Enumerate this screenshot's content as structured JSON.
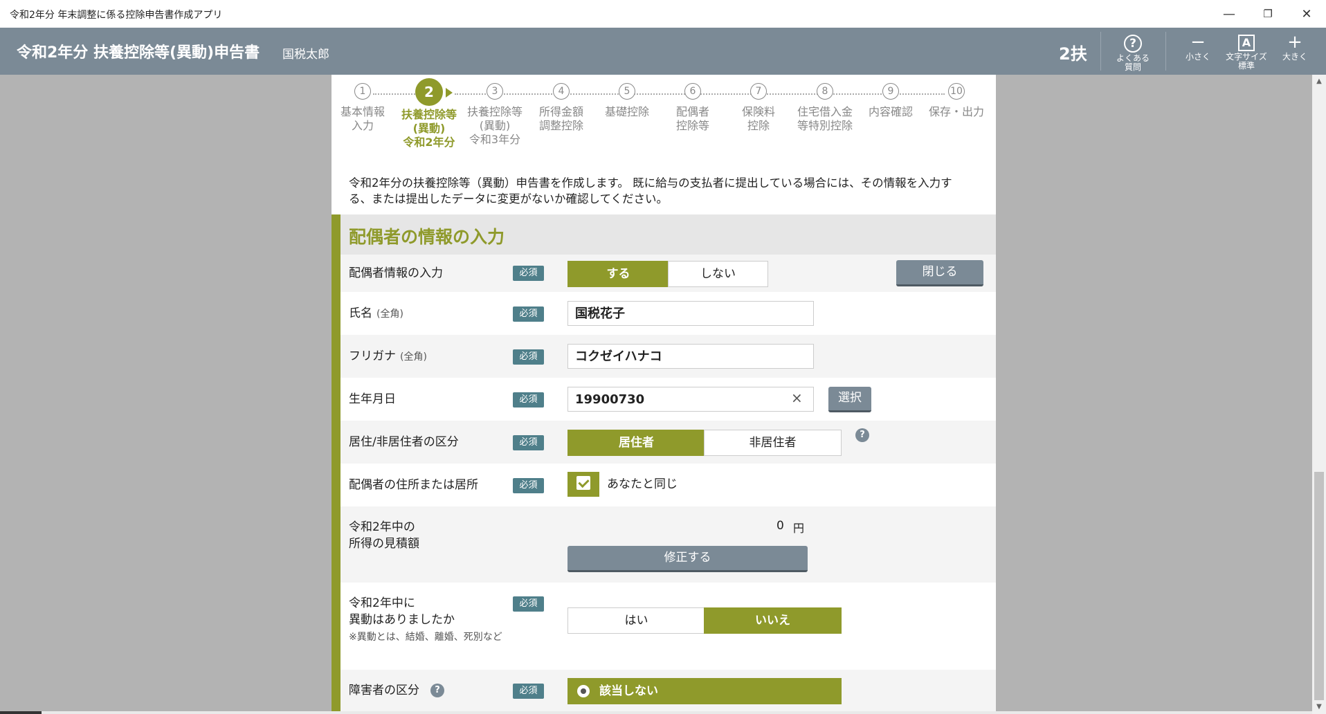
{
  "window": {
    "title": "令和2年分 年末調整に係る控除申告書作成アプリ",
    "minimize_glyph": "—",
    "restore_glyph": "❐",
    "close_glyph": "✕"
  },
  "header": {
    "title": "令和2年分 扶養控除等(異動)申告書",
    "user": "国税太郎",
    "badge": "2扶",
    "tools": {
      "faq_icon": "?",
      "faq_label": "よくある\n質問",
      "smaller_icon": "−",
      "smaller_label": "小さく",
      "fontsize_icon": "A",
      "fontsize_label": "文字サイズ\n標準",
      "larger_icon": "+",
      "larger_label": "大きく"
    }
  },
  "steps": [
    {
      "num": "1",
      "label": "基本情報\n入力"
    },
    {
      "num": "2",
      "label": "扶養控除等\n(異動)\n令和2年分"
    },
    {
      "num": "3",
      "label": "扶養控除等\n(異動)\n令和3年分"
    },
    {
      "num": "4",
      "label": "所得金額\n調整控除"
    },
    {
      "num": "5",
      "label": "基礎控除"
    },
    {
      "num": "6",
      "label": "配偶者\n控除等"
    },
    {
      "num": "7",
      "label": "保険料\n控除"
    },
    {
      "num": "8",
      "label": "住宅借入金\n等特別控除"
    },
    {
      "num": "9",
      "label": "内容確認"
    },
    {
      "num": "10",
      "label": "保存・出力"
    }
  ],
  "intro": "令和2年分の扶養控除等（異動）申告書を作成します。 既に給与の支払者に提出している場合には、その情報を入力する、または提出したデータに変更がないか確認してください。",
  "section": {
    "title": "配偶者の情報の入力",
    "required_label": "必須",
    "help_glyph": "?",
    "rows": {
      "input_flag": {
        "label": "配偶者情報の入力",
        "on": "する",
        "off": "しない",
        "close_button": "閉じる"
      },
      "name": {
        "label": "氏名",
        "hint": "(全角)",
        "value": "国税花子"
      },
      "kana": {
        "label": "フリガナ",
        "hint": "(全角)",
        "value": "コクゼイハナコ"
      },
      "birth": {
        "label": "生年月日",
        "value": "19900730",
        "clear_glyph": "×",
        "select_button": "選択"
      },
      "residency": {
        "label": "居住/非居住者の区分",
        "on": "居住者",
        "off": "非居住者"
      },
      "address": {
        "label": "配偶者の住所または居所",
        "checkbox_label": "あなたと同じ"
      },
      "income": {
        "label_line1": "令和2年中の",
        "label_line2": "所得の見積額",
        "amount": "0",
        "unit": "円",
        "edit_button": "修正する"
      },
      "change": {
        "label_line1": "令和2年中に",
        "label_line2": "異動はありましたか",
        "note": "※異動とは、結婚、離婚、死別など",
        "yes": "はい",
        "no": "いいえ"
      },
      "disability": {
        "label": "障害者の区分",
        "option": "該当しない"
      }
    }
  }
}
